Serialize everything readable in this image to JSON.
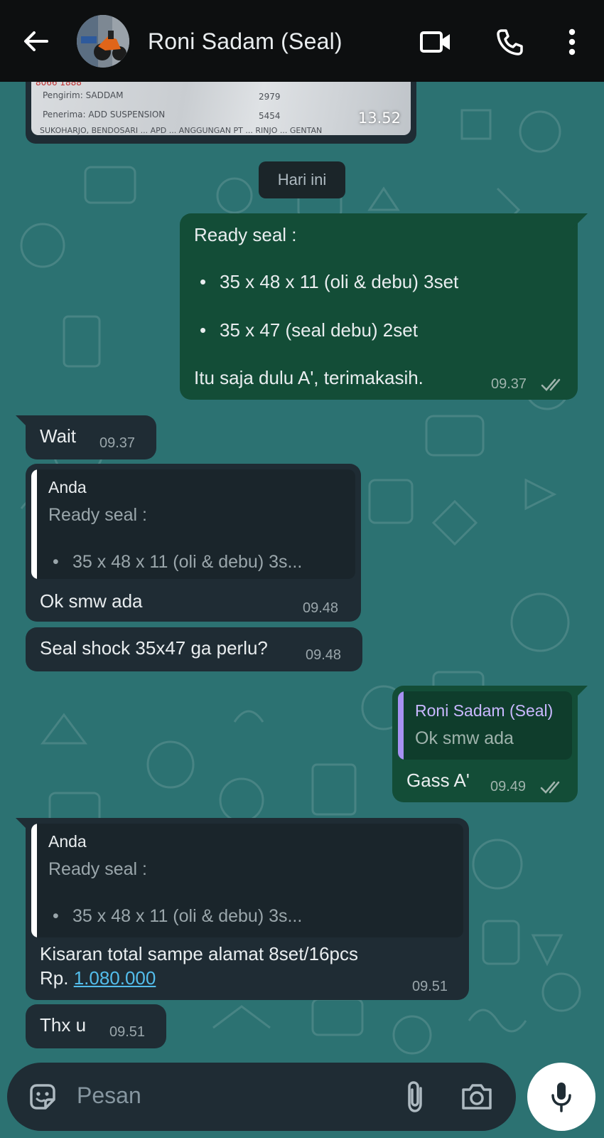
{
  "header": {
    "contact_name": "Roni Sadam (Seal)"
  },
  "top_image": {
    "time": "13.52",
    "lines": [
      "8066 1888",
      "Pengirim: SADDAM",
      "Penerima: ADD SUSPENSION",
      "2979",
      "5454",
      "SUKOHARJO, BENDOSARI ... APD ... ANGGUNGAN PT ... RINJO ... GENTAN"
    ]
  },
  "date_chip": "Hari ini",
  "messages": [
    {
      "dir": "out",
      "title": "Ready seal :",
      "bullet1": "35 x 48 x 11 (oli & debu) 3set",
      "bullet2": "35 x 47 (seal debu) 2set",
      "footer": "Itu saja dulu A', terimakasih.",
      "time": "09.37",
      "status": "read"
    },
    {
      "dir": "in",
      "text": "Wait",
      "time": "09.37"
    },
    {
      "dir": "in",
      "quote_name": "Anda",
      "quote_line1": "Ready seal :",
      "quote_line2": "35 x 48 x 11 (oli & debu) 3s...",
      "text": "Ok smw ada",
      "time": "09.48"
    },
    {
      "dir": "in",
      "text": "Seal shock 35x47 ga perlu?",
      "time": "09.48"
    },
    {
      "dir": "out",
      "quote_name": "Roni Sadam (Seal)",
      "quote_line1": "Ok smw ada",
      "text": "Gass A'",
      "time": "09.49",
      "status": "read"
    },
    {
      "dir": "in",
      "quote_name": "Anda",
      "quote_line1": "Ready seal :",
      "quote_line2": "35 x 48 x 11 (oli & debu) 3s...",
      "text_line1": "Kisaran total sampe alamat 8set/16pcs",
      "text_prefix": "Rp. ",
      "text_link": "1.080.000",
      "time": "09.51"
    },
    {
      "dir": "in",
      "text": "Thx u",
      "time": "09.51"
    }
  ],
  "input": {
    "placeholder": "Pesan"
  },
  "colors": {
    "header_bg": "#0d0f10",
    "wallpaper": "#2c7272",
    "outgoing_bubble": "#134d37",
    "incoming_bubble": "#1f2c34",
    "quote_bar_self": "#ffffff",
    "quote_bar_contact": "#a791f2",
    "quote_name_contact": "#c9b8ff",
    "link": "#53bdeb",
    "read_ticks": "#9fb3ac"
  },
  "icons": [
    "back-arrow-icon",
    "video-call-icon",
    "voice-call-icon",
    "more-vert-icon",
    "sticker-icon",
    "attach-icon",
    "camera-icon",
    "mic-icon",
    "double-check-icon"
  ]
}
